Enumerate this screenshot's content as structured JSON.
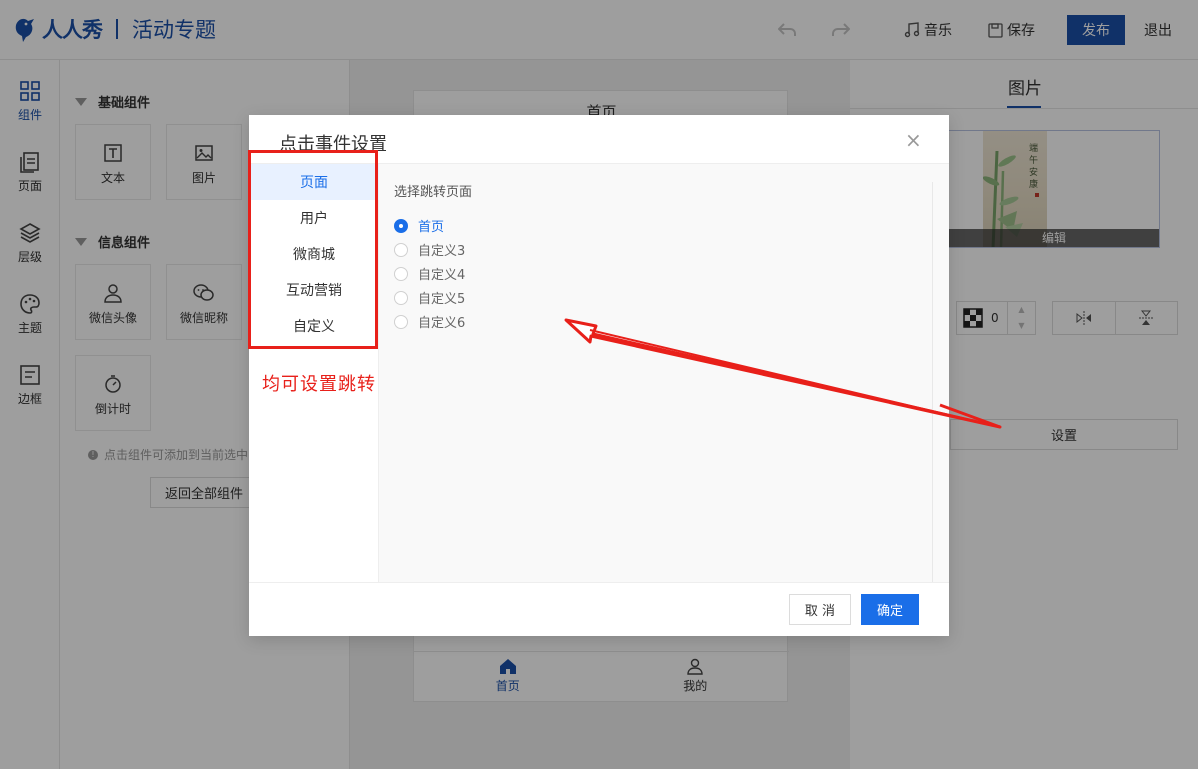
{
  "header": {
    "brand": "人人秀",
    "title": "活动专题",
    "music_label": "音乐",
    "save_label": "保存",
    "publish_label": "发布",
    "exit_label": "退出"
  },
  "rail": {
    "items": [
      {
        "label": "组件",
        "icon": "grid-icon"
      },
      {
        "label": "页面",
        "icon": "pages-icon"
      },
      {
        "label": "层级",
        "icon": "layers-icon"
      },
      {
        "label": "主题",
        "icon": "palette-icon"
      },
      {
        "label": "边框",
        "icon": "border-icon"
      }
    ]
  },
  "components": {
    "basic_title": "基础组件",
    "basic_items": [
      {
        "label": "文本",
        "icon": "text-icon"
      },
      {
        "label": "图片",
        "icon": "image-icon"
      }
    ],
    "info_title": "信息组件",
    "info_items": [
      {
        "label": "微信头像",
        "icon": "user-icon"
      },
      {
        "label": "微信昵称",
        "icon": "wechat-icon"
      },
      {
        "label": "倒计时",
        "icon": "timer-icon"
      }
    ],
    "tip": "点击组件可添加到当前选中",
    "back_label": "返回全部组件"
  },
  "canvas": {
    "page_title": "首页",
    "tabs": [
      {
        "label": "首页",
        "icon": "home-icon"
      },
      {
        "label": "我的",
        "icon": "user-icon"
      }
    ]
  },
  "right_panel": {
    "title": "图片",
    "edit_label": "编辑",
    "stepper_value": "0",
    "set_label": "设置"
  },
  "modal": {
    "title": "点击事件设置",
    "nav": [
      "页面",
      "用户",
      "微商城",
      "互动营销",
      "自定义"
    ],
    "content_label": "选择跳转页面",
    "options": [
      "首页",
      "自定义3",
      "自定义4",
      "自定义5",
      "自定义6"
    ],
    "selected_index": 0,
    "cancel_label": "取 消",
    "ok_label": "确定"
  },
  "annotation": {
    "text": "均可设置跳转",
    "color": "#e8201a"
  },
  "colors": {
    "brand": "#1a4fa8",
    "accent": "#1a6ee8"
  }
}
